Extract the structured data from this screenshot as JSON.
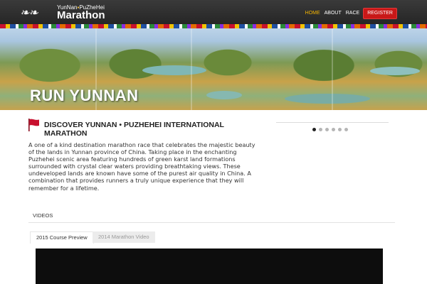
{
  "header": {
    "logo": {
      "line1_a": "YunNan",
      "line1_b": "PuZheHei",
      "line2": "Marathon"
    },
    "nav": [
      {
        "label": "HOME",
        "active": true
      },
      {
        "label": "ABOUT",
        "active": false
      },
      {
        "label": "RACE",
        "active": false
      },
      {
        "label": "REGISTER",
        "active": false
      }
    ]
  },
  "banner": {
    "title": "RUN YUNNAN"
  },
  "intro": {
    "title": "DISCOVER YUNNAN • PUZHEHEI INTERNATIONAL MARATHON",
    "body": "A one of a kind destination marathon race that celebrates the majestic beauty of the lands in Yunnan province of China. Taking place in the enchanting Puzhehei scenic area featuring hundreds of green karst land formations surrounded with crystal clear waters providing breathtaking views. These undeveloped lands are known have some of the purest air quality in China. A combination that provides runners a truly unique experience that they will remember for a lifetime."
  },
  "slider": {
    "dot_count": 6,
    "active_index": 0
  },
  "videos": {
    "label": "VIDEOS",
    "tabs": [
      {
        "label": "2015 Course Preview",
        "active": true
      },
      {
        "label": "2014 Marathon Video",
        "active": false
      }
    ]
  },
  "colors": {
    "header_bg": "#2f2f2f",
    "nav_active": "#f4b400",
    "register_bg": "#c91818",
    "flag_red": "#c8102e"
  }
}
